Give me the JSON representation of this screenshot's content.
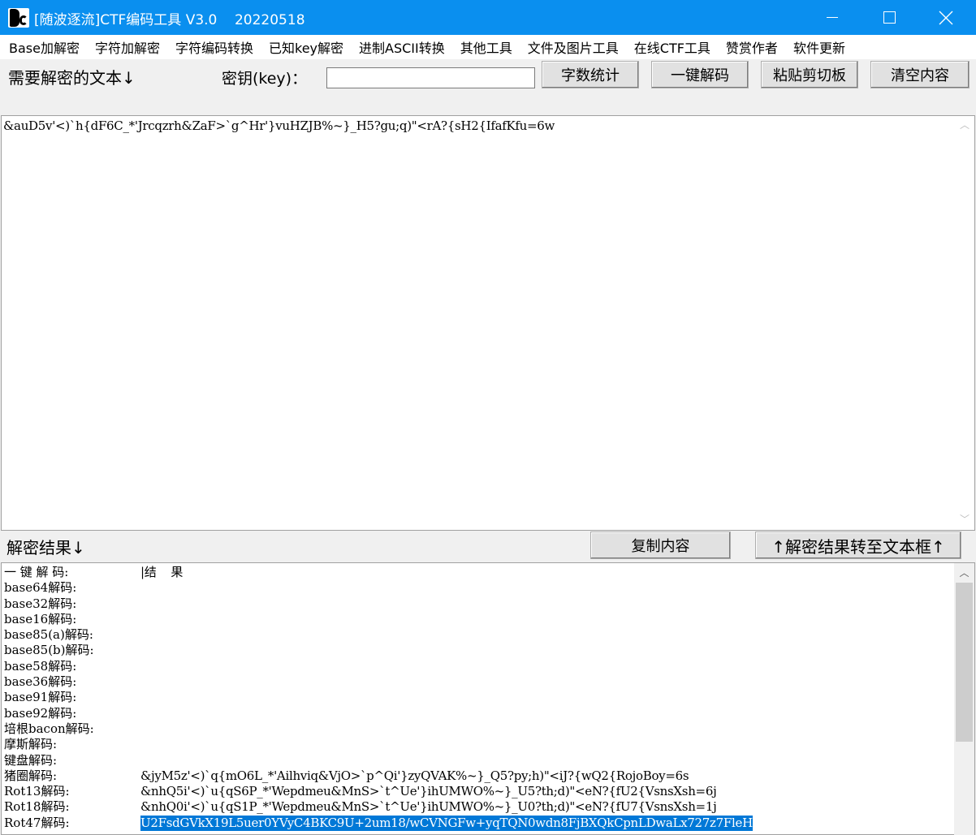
{
  "window": {
    "title": "[随波逐流]CTF编码工具 V3.0    20220518",
    "controls": {
      "minimize": "minimize",
      "maximize": "maximize",
      "close": "close"
    }
  },
  "menu": {
    "items": [
      "Base加解密",
      "字符加解密",
      "字符编码转换",
      "已知key解密",
      "进制ASCII转换",
      "其他工具",
      "文件及图片工具",
      "在线CTF工具",
      "赞赏作者",
      "软件更新"
    ]
  },
  "toolbar": {
    "need_label": "需要解密的文本↓",
    "key_label": "密钥(key)：",
    "key_value": "",
    "count_button": "字数统计",
    "decode_button": "一键解码",
    "paste_button": "粘贴剪切板",
    "clear_button": "清空内容"
  },
  "input_text": "&auD5v'<)`h{dF6C_*'Jrcqzrh&ZaF>`g^Hr'}vuHZJB%~}_H5?gu;q)\"<rA?{sH2{IfafKfu=6w",
  "result": {
    "label": "解密结果↓",
    "copy_button": "复制内容",
    "to_textbox_button": "↑解密结果转至文本框↑",
    "header": {
      "label": "一 键 解 码:",
      "value": "|结    果"
    },
    "rows": [
      {
        "label": "base64解码:",
        "value": ""
      },
      {
        "label": "base32解码:",
        "value": ""
      },
      {
        "label": "base16解码:",
        "value": ""
      },
      {
        "label": "base85(a)解码:",
        "value": ""
      },
      {
        "label": "base85(b)解码:",
        "value": ""
      },
      {
        "label": "base58解码:",
        "value": ""
      },
      {
        "label": "base36解码:",
        "value": ""
      },
      {
        "label": "base91解码:",
        "value": ""
      },
      {
        "label": "base92解码:",
        "value": ""
      },
      {
        "label": "培根bacon解码:",
        "value": ""
      },
      {
        "label": "摩斯解码:",
        "value": ""
      },
      {
        "label": "键盘解码:",
        "value": ""
      },
      {
        "label": "猪圈解码:",
        "value": "&jyM5z'<)`q{mO6L_*'Ailhviq&VjO>`p^Qi'}zyQVAK%~}_Q5?py;h)\"<iJ?{wQ2{RojoBoy=6s"
      },
      {
        "label": "Rot13解码:",
        "value": "&nhQ5i'<)`u{qS6P_*'Wepdmeu&MnS>`t^Ue'}ihUMWO%~}_U5?th;d)\"<eN?{fU2{VsnsXsh=6j"
      },
      {
        "label": "Rot18解码:",
        "value": "&nhQ0i'<)`u{qS1P_*'Wepdmeu&MnS>`t^Ue'}ihUMWO%~}_U0?th;d)\"<eN?{fU7{VsnsXsh=1j"
      },
      {
        "label": "Rot47解码:",
        "value": "U2FsdGVkX19L5uer0YVyC4BKC9U+2um18/wCVNGFw+yqTQN0wdn8FjBXQkCpnLDwaLx727z7FleH",
        "selected": true
      }
    ]
  }
}
